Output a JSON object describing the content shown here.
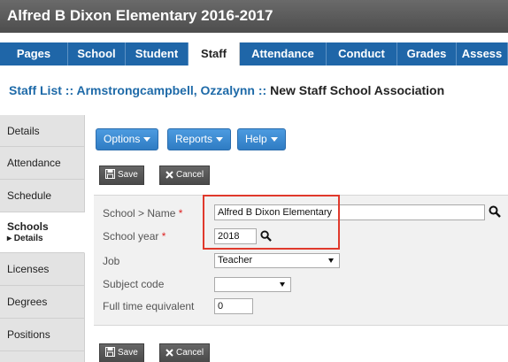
{
  "window": {
    "title": "Alfred B Dixon Elementary 2016-2017"
  },
  "tabs": [
    {
      "label": "Pages"
    },
    {
      "label": "School"
    },
    {
      "label": "Student"
    },
    {
      "label": "Staff",
      "active": true
    },
    {
      "label": "Attendance"
    },
    {
      "label": "Conduct"
    },
    {
      "label": "Grades"
    },
    {
      "label": "Assess"
    }
  ],
  "breadcrumb": {
    "part1": "Staff List",
    "sep": " :: ",
    "part2": "Armstrongcampbell, Ozzalynn",
    "part3": "New Staff School Association"
  },
  "sidebar": {
    "items": [
      {
        "label": "Details"
      },
      {
        "label": "Attendance"
      },
      {
        "label": "Schedule"
      },
      {
        "label": "Schools",
        "sub": "▸ Details",
        "active": true
      },
      {
        "label": "Licenses"
      },
      {
        "label": "Degrees"
      },
      {
        "label": "Positions"
      }
    ]
  },
  "toolbar": {
    "options_label": "Options",
    "reports_label": "Reports",
    "help_label": "Help",
    "save_label": "Save",
    "cancel_label": "Cancel"
  },
  "form": {
    "school_name": {
      "label": "School > Name",
      "required": "*",
      "value": "Alfred B Dixon Elementary"
    },
    "school_year": {
      "label": "School year",
      "required": "*",
      "value": "2018"
    },
    "job": {
      "label": "Job",
      "value": "Teacher"
    },
    "subject_code": {
      "label": "Subject code",
      "value": ""
    },
    "full_time_equivalent": {
      "label": "Full time equivalent",
      "value": "0"
    }
  },
  "colors": {
    "tab_bar": "#1f66a8",
    "link": "#1e6aa8",
    "button_blue": "#2f7cc3",
    "highlight": "#e0392c"
  },
  "icons": {
    "search": "magnifier-icon",
    "save": "floppy-disk-icon",
    "cancel": "x-icon"
  }
}
